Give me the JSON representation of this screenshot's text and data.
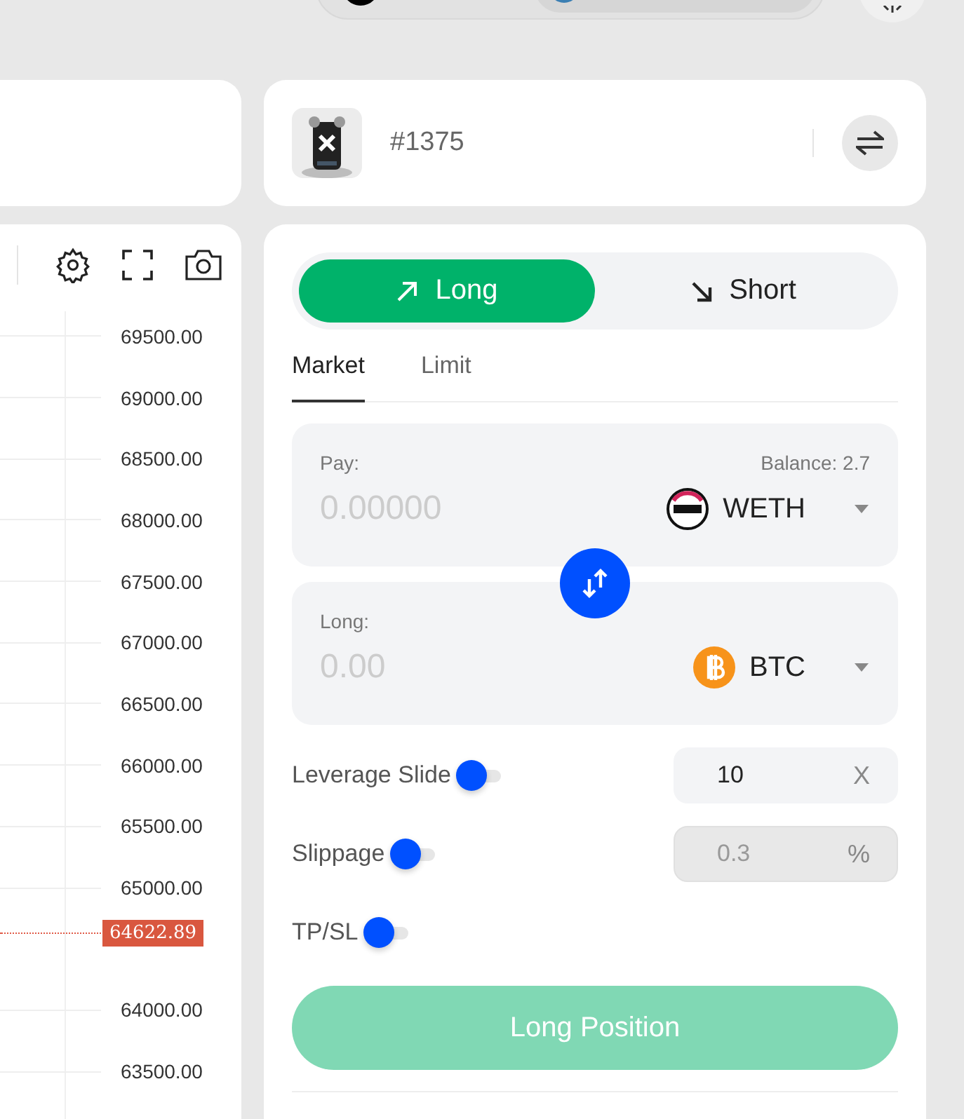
{
  "top_card": {
    "token_id": "#1375"
  },
  "chart": {
    "price_labels": [
      "69500.00",
      "69000.00",
      "68500.00",
      "68000.00",
      "67500.00",
      "67000.00",
      "66500.00",
      "66000.00",
      "65500.00",
      "65000.00",
      "64000.00",
      "63500.00"
    ],
    "last_price": "64622.89"
  },
  "trade": {
    "sides": [
      {
        "label": "Long",
        "kind": "long",
        "selected": true
      },
      {
        "label": "Short",
        "kind": "short",
        "selected": false
      }
    ],
    "order_tabs": [
      {
        "label": "Market",
        "selected": true
      },
      {
        "label": "Limit",
        "selected": false
      }
    ],
    "token_boxes": [
      {
        "kind": "weth",
        "label": "Pay:",
        "balance": "Balance: 2.7",
        "placeholder": "0.00000",
        "token": "WETH"
      },
      {
        "kind": "btc",
        "label": "Long:",
        "placeholder": "0.00",
        "token": "BTC"
      }
    ],
    "options": [
      {
        "label": "Leverage Slide",
        "on": false,
        "field": {
          "value": "10",
          "unit": "X",
          "disabled": false
        }
      },
      {
        "label": "Slippage",
        "on": false,
        "field": {
          "value": "0.3",
          "unit": "%",
          "disabled": true
        }
      },
      {
        "label": "TP/SL",
        "on": false
      }
    ],
    "submit": {
      "label": "Long Position",
      "disabled": true
    }
  }
}
